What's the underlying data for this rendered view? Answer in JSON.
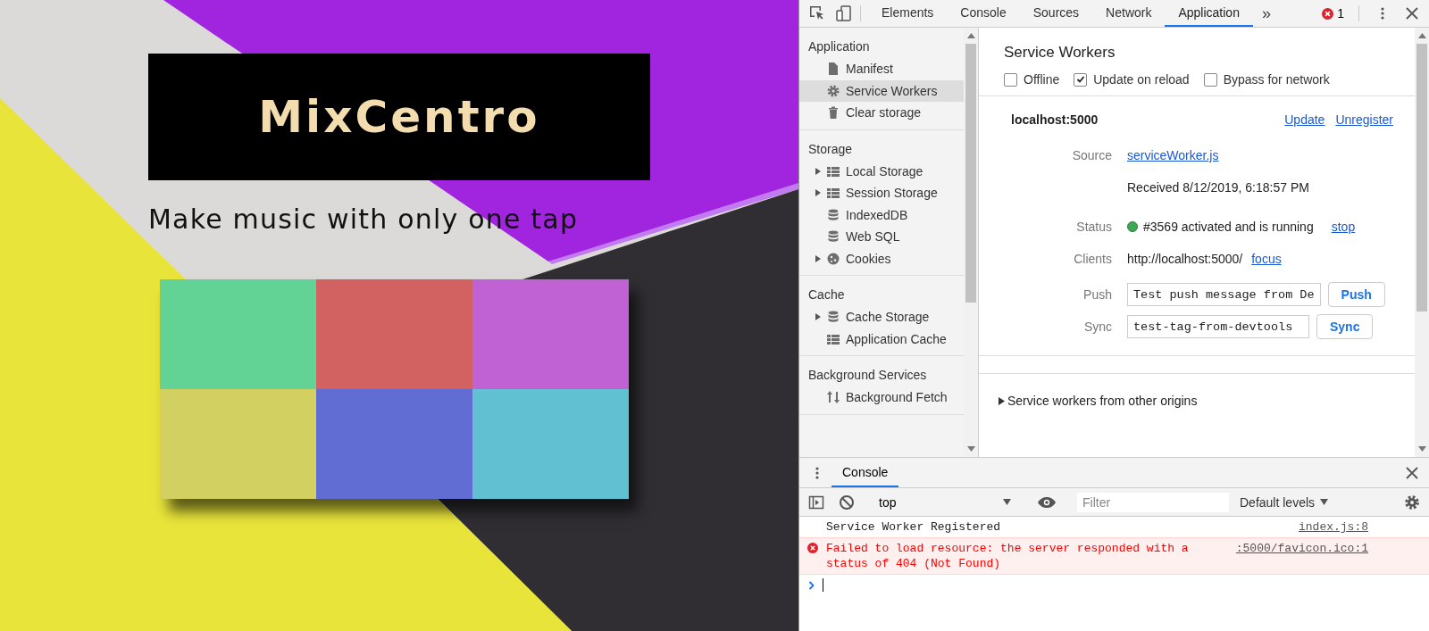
{
  "page": {
    "logo": "MixCentro",
    "tagline": "Make music with only one tap",
    "pads": [
      {
        "color": "#62d394"
      },
      {
        "color": "#d26262"
      },
      {
        "color": "#c062d3"
      },
      {
        "color": "#d3d062"
      },
      {
        "color": "#626dd3"
      },
      {
        "color": "#62c0d3"
      }
    ]
  },
  "devtools": {
    "tabs": [
      {
        "label": "Elements",
        "selected": false
      },
      {
        "label": "Console",
        "selected": false
      },
      {
        "label": "Sources",
        "selected": false
      },
      {
        "label": "Network",
        "selected": false
      },
      {
        "label": "Application",
        "selected": true
      }
    ],
    "more_tabs": "»",
    "error_count": "1",
    "sidebar": [
      {
        "title": "Application",
        "items": [
          {
            "label": "Manifest",
            "kind": "file",
            "expandable": false,
            "selected": false
          },
          {
            "label": "Service Workers",
            "kind": "gear",
            "expandable": false,
            "selected": true
          },
          {
            "label": "Clear storage",
            "kind": "trash",
            "expandable": false,
            "selected": false
          }
        ]
      },
      {
        "title": "Storage",
        "items": [
          {
            "label": "Local Storage",
            "kind": "grid",
            "expandable": true,
            "selected": false
          },
          {
            "label": "Session Storage",
            "kind": "grid",
            "expandable": true,
            "selected": false
          },
          {
            "label": "IndexedDB",
            "kind": "database",
            "expandable": false,
            "selected": false
          },
          {
            "label": "Web SQL",
            "kind": "database",
            "expandable": false,
            "selected": false
          },
          {
            "label": "Cookies",
            "kind": "cookie",
            "expandable": true,
            "selected": false
          }
        ]
      },
      {
        "title": "Cache",
        "items": [
          {
            "label": "Cache Storage",
            "kind": "database",
            "expandable": true,
            "selected": false
          },
          {
            "label": "Application Cache",
            "kind": "grid",
            "expandable": false,
            "selected": false
          }
        ]
      },
      {
        "title": "Background Services",
        "items": [
          {
            "label": "Background Fetch",
            "kind": "arrows",
            "expandable": false,
            "selected": false
          }
        ]
      }
    ],
    "main": {
      "title": "Service Workers",
      "options": [
        {
          "label": "Offline",
          "checked": false
        },
        {
          "label": "Update on reload",
          "checked": true
        },
        {
          "label": "Bypass for network",
          "checked": false
        }
      ],
      "origin": "localhost:5000",
      "actions": [
        "Update",
        "Unregister"
      ],
      "source_label": "Source",
      "source_link": "serviceWorker.js",
      "received": "Received 8/12/2019, 6:18:57 PM",
      "status_label": "Status",
      "status_text": "#3569 activated and is running",
      "status_action": "stop",
      "clients_label": "Clients",
      "clients_url": "http://localhost:5000/",
      "clients_action": "focus",
      "push_label": "Push",
      "push_value": "Test push message from De",
      "push_button": "Push",
      "sync_label": "Sync",
      "sync_value": "test-tag-from-devtools",
      "sync_button": "Sync",
      "other_origins": "Service workers from other origins"
    },
    "drawer": {
      "tabs": [
        {
          "label": "Console",
          "selected": true
        }
      ],
      "context": "top",
      "filter_placeholder": "Filter",
      "levels": "Default levels",
      "messages": [
        {
          "kind": "log",
          "text": "Service Worker Registered",
          "source": "index.js:8"
        },
        {
          "kind": "error",
          "text": "Failed to load resource: the server responded with a status of 404 (Not Found)",
          "source": ":5000/favicon.ico:1"
        }
      ]
    }
  }
}
